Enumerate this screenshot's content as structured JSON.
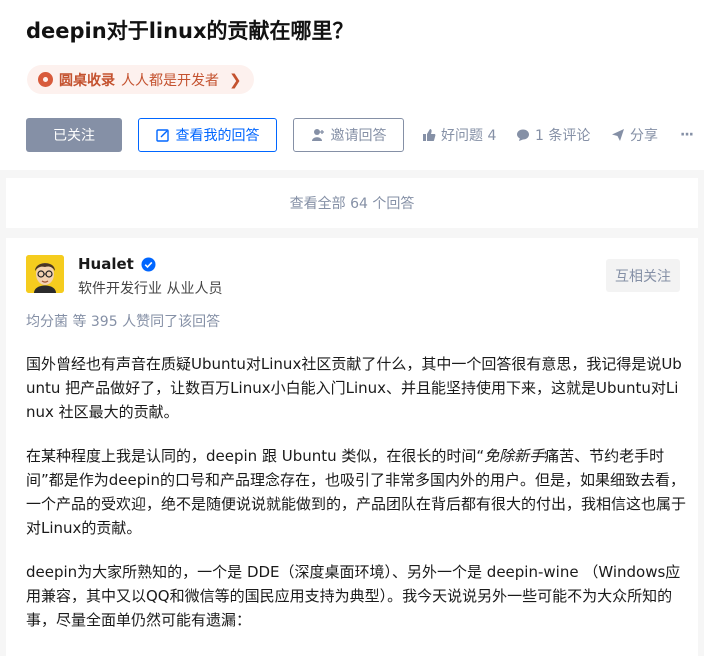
{
  "question": {
    "title": "deepin对于linux的贡献在哪里？",
    "topic": {
      "name": "圆桌收录",
      "desc": "人人都是开发者",
      "arrow": "❯"
    }
  },
  "actions": {
    "followed": "已关注",
    "view_my_answer": "查看我的回答",
    "invite": "邀请回答",
    "good_question": "好问题 4",
    "comments": "1 条评论",
    "share": "分享",
    "more": "···"
  },
  "view_all": "查看全部 64 个回答",
  "answer": {
    "author": {
      "name": "Hualet",
      "headline": "软件开发行业 从业人员"
    },
    "follow_label": "互相关注",
    "voters": "均分菌 等 395 人赞同了该回答",
    "paragraphs": {
      "p1": "国外曾经也有声音在质疑Ubuntu对Linux社区贡献了什么，其中一个回答很有意思，我记得是说Ubuntu 把产品做好了，让数百万Linux小白能入门Linux、并且能坚持使用下来，这就是Ubuntu对Linux 社区最大的贡献。",
      "p2a": "在某种程度上我是认同的，deepin 跟 Ubuntu 类似，在很长的时间“",
      "p2em": "免除新手",
      "p2b": "痛苦、节约老手时间”都是作为deepin的口号和产品理念存在，也吸引了非常多国内外的用户。但是，如果细致去看，一个产品的受欢迎，绝不是随便说说就能做到的，产品团队在背后都有很大的付出，我相信这也属于对Linux的贡献。",
      "p3": "deepin为大家所熟知的，一个是 DDE（深度桌面环境）、另外一个是 deepin-wine （Windows应用兼容，其中又以QQ和微信等的国民应用支持为典型）。我今天说说另外一些可能不为大众所知的事，尽量全面单仍然可能有遗漏："
    }
  },
  "colors": {
    "brand_blue": "#0066ff",
    "gray_text": "#8590a6",
    "topic_accent": "#c4522f",
    "topic_bg": "#fdf1ee",
    "followed_bg": "#8590a6"
  },
  "icons": {
    "topic": "roundtable-icon",
    "view_my_answer": "edit-icon",
    "invite": "add-user-icon",
    "good_question": "thumbs-up-icon",
    "comments": "comment-bubble-icon",
    "share": "paper-plane-icon",
    "verified": "verified-badge-icon"
  }
}
